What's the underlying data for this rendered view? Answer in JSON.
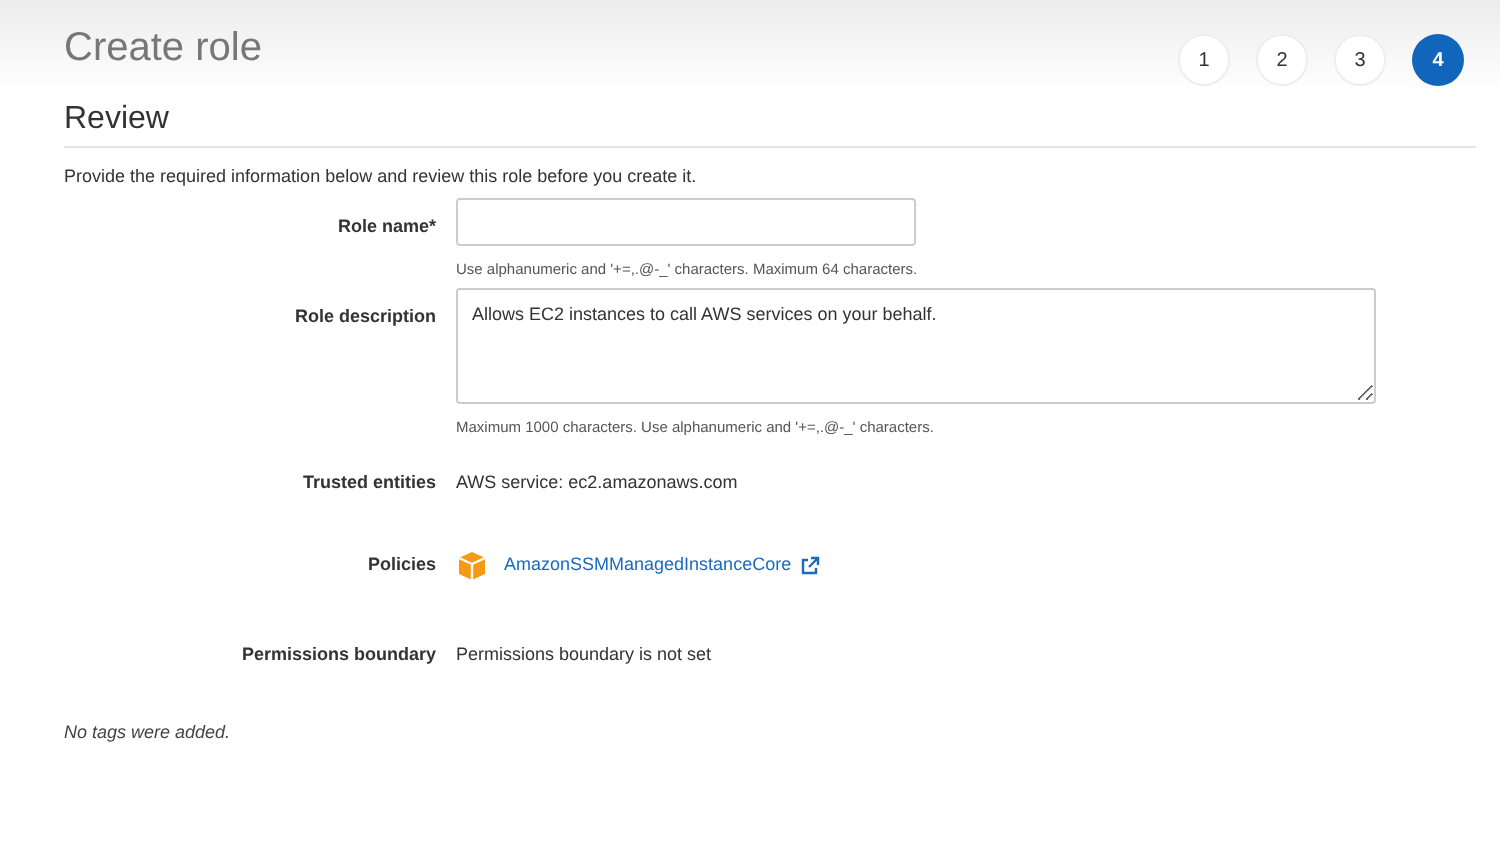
{
  "header": {
    "title": "Create role"
  },
  "steps": [
    {
      "label": "1",
      "selected": false
    },
    {
      "label": "2",
      "selected": false
    },
    {
      "label": "3",
      "selected": false
    },
    {
      "label": "4",
      "selected": true
    }
  ],
  "section": {
    "title": "Review",
    "intro": "Provide the required information below and review this role before you create it."
  },
  "fields": [
    {
      "kind": "input",
      "label": "Role name*",
      "hint": "Use alphanumeric and '+=,.@-_' characters. Maximum 64 characters."
    },
    {
      "kind": "textarea",
      "label": "Role description",
      "value": "Allows EC2 instances to call AWS services on your behalf.",
      "hint": "Maximum 1000 characters. Use alphanumeric and '+=,.@-_' characters."
    },
    {
      "kind": "text",
      "label": "Trusted entities",
      "value": "AWS service: ec2.amazonaws.com"
    },
    {
      "kind": "policy",
      "label": "Policies",
      "value": "AmazonSSMManagedInstanceCore"
    },
    {
      "kind": "text",
      "label": "Permissions boundary",
      "value": "Permissions boundary is not set"
    }
  ],
  "tags_note": "No tags were added."
}
